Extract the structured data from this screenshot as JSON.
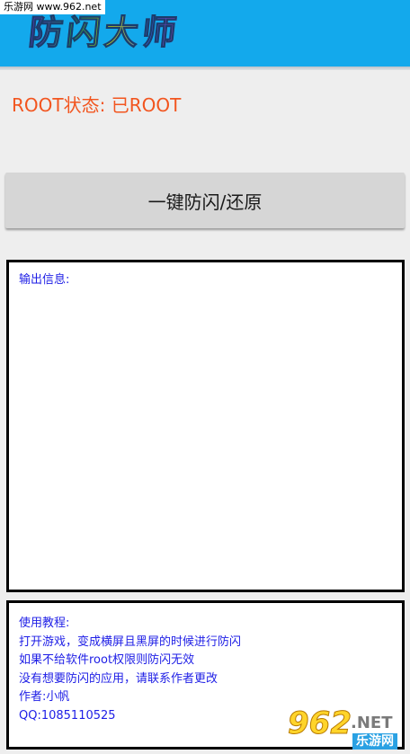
{
  "app": {
    "title": "防闪大师",
    "root_status": "ROOT状态: 已ROOT"
  },
  "actions": {
    "toggle_label": "一键防闪/还原"
  },
  "output": {
    "label": "输出信息:"
  },
  "help": {
    "lines": [
      "使用教程:",
      "打开游戏，变成横屏且黑屏的时候进行防闪",
      "如果不给软件root权限则防闪无效",
      "没有想要防闪的应用，请联系作者更改",
      "作者:小帆",
      "QQ:1085110525"
    ]
  },
  "watermark": {
    "top_text": "乐游网 www.962.net",
    "logo_number": "962",
    "logo_suffix": ".NET",
    "logo_cn": "乐游网"
  },
  "colors": {
    "header_bg": "#13a9ec",
    "status_text": "#f2551f",
    "info_text": "#1e1ee6",
    "button_bg": "#d6d6d6"
  }
}
